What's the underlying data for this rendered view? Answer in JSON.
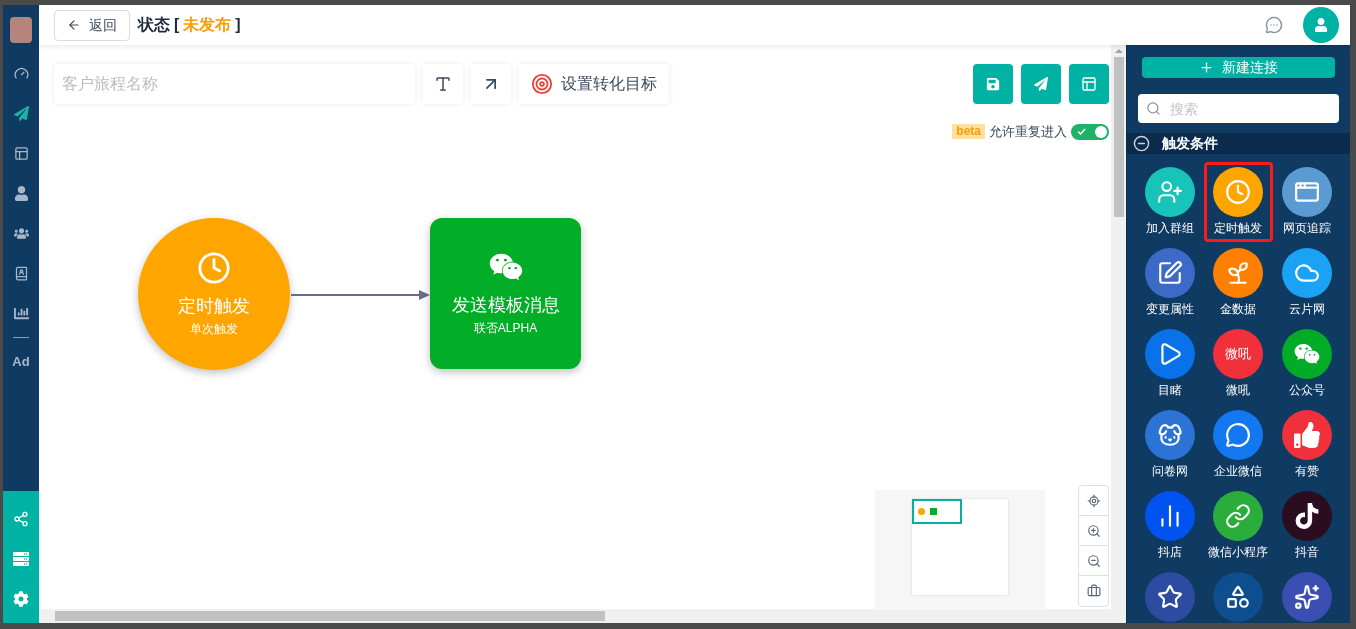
{
  "sidebar": {
    "items": [
      {
        "selected": false
      },
      {
        "selected": true
      },
      {
        "selected": false
      },
      {
        "selected": false
      },
      {
        "selected": false
      },
      {
        "selected": false
      },
      {
        "selected": false
      },
      {
        "selected": false,
        "text": "Ad"
      }
    ],
    "bottom_items": [
      {
        "selected": false
      },
      {
        "selected": false
      },
      {
        "selected": false
      }
    ]
  },
  "header": {
    "back": "返回",
    "status_label": "状态",
    "status_value": "未发布",
    "brackets": [
      "[",
      "]"
    ]
  },
  "toolbar": {
    "name_placeholder": "客户旅程名称",
    "goal_button": "设置转化目标",
    "badge": "beta",
    "reentry_label": "允许重复进入",
    "reentry_on": true
  },
  "flow": {
    "trigger": {
      "title": "定时触发",
      "subtitle": "单次触发"
    },
    "action": {
      "title": "发送模板消息",
      "subtitle": "联否ALPHA"
    }
  },
  "panel": {
    "new_button": "新建连接",
    "search_placeholder": "搜索",
    "section": {
      "title": "触发条件",
      "expanded": true,
      "tiles": [
        {
          "label": "加入群组",
          "color": "#18c3b9",
          "selected": false
        },
        {
          "label": "定时触发",
          "color": "#ffa500",
          "selected": true
        },
        {
          "label": "网页追踪",
          "color": "#5b9bd1",
          "selected": false
        },
        {
          "label": "变更属性",
          "color": "#3d6ac6",
          "selected": false
        },
        {
          "label": "金数据",
          "color": "#ff7f00",
          "selected": false
        },
        {
          "label": "云片网",
          "color": "#1aa3f5",
          "selected": false
        },
        {
          "label": "目睹",
          "color": "#0a72e8",
          "selected": false
        },
        {
          "label": "微吼",
          "color": "#f0303a",
          "selected": false,
          "kind": "text_logo"
        },
        {
          "label": "公众号",
          "color": "#02ac26",
          "selected": false
        },
        {
          "label": "问卷网",
          "color": "#2b73d5",
          "selected": false
        },
        {
          "label": "企业微信",
          "color": "#1378f0",
          "selected": false
        },
        {
          "label": "有赞",
          "color": "#f0303a",
          "selected": false
        },
        {
          "label": "抖店",
          "color": "#0053f0",
          "selected": false
        },
        {
          "label": "微信小程序",
          "color": "#2aad3b",
          "selected": false
        },
        {
          "label": "抖音",
          "color": "#2a0d1f",
          "selected": false
        },
        {
          "color": "#2d4ba0",
          "selected": false
        },
        {
          "color": "#0e4d8e",
          "selected": false
        },
        {
          "color": "#3b4fb2",
          "selected": false
        }
      ],
      "logo_texts": [
        "微吼"
      ]
    }
  }
}
